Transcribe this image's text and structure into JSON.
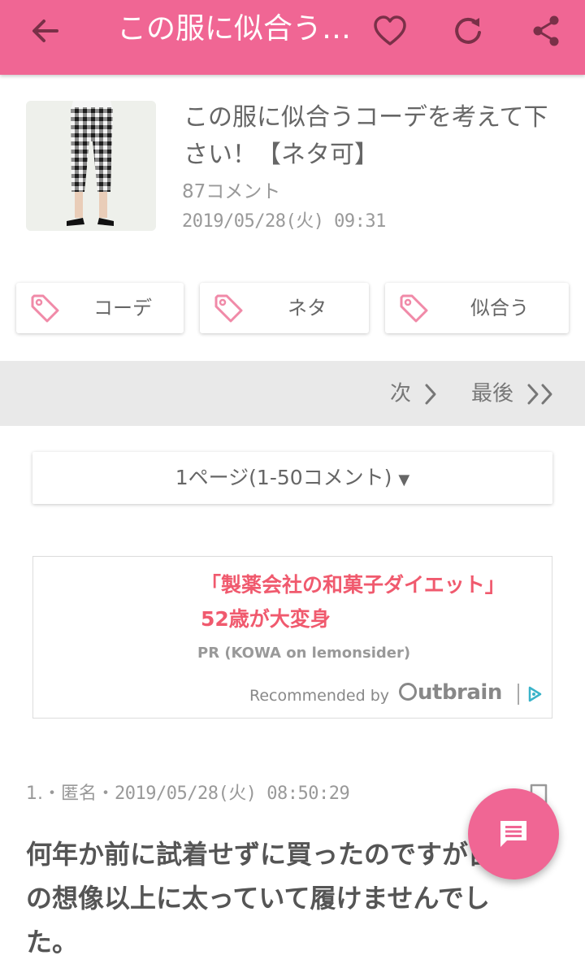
{
  "header": {
    "title": "この服に似合うコーデを考えて下さい！【ネタ可】",
    "accent_color": "#f06694",
    "icons": [
      "back-arrow-icon",
      "heart-icon",
      "refresh-icon",
      "share-icon"
    ]
  },
  "article": {
    "title": "この服に似合うコーデを考えて下さい！【ネタ可】",
    "comment_count": "87コメント",
    "date": "2019/05/28(火) 09:31"
  },
  "tags": [
    {
      "label": "コーデ",
      "icon": "tag-icon"
    },
    {
      "label": "ネタ",
      "icon": "tag-icon"
    },
    {
      "label": "似合う",
      "icon": "tag-icon"
    }
  ],
  "pager": {
    "next_label": "次",
    "last_label": "最後"
  },
  "page_select": {
    "selected": "1ページ(1-50コメント)",
    "arrow": "▼"
  },
  "ad": {
    "headline": "「製薬会社の和菓子ダイエット」52歳が大変身",
    "sponsor": "PR (KOWA on lemonsider)",
    "recommended_by": "Recommended by",
    "brand": "utbrain",
    "headline_color": "#f05a6e"
  },
  "comment": {
    "number": "1.",
    "name": "匿名",
    "separator": "・",
    "date": "2019/05/28(火) 08:50:29",
    "body": "何年か前に試着せずに買ったのですが自分の想像以上に太っていて履けませんでした。"
  },
  "fab": {
    "icon": "comment-icon"
  }
}
